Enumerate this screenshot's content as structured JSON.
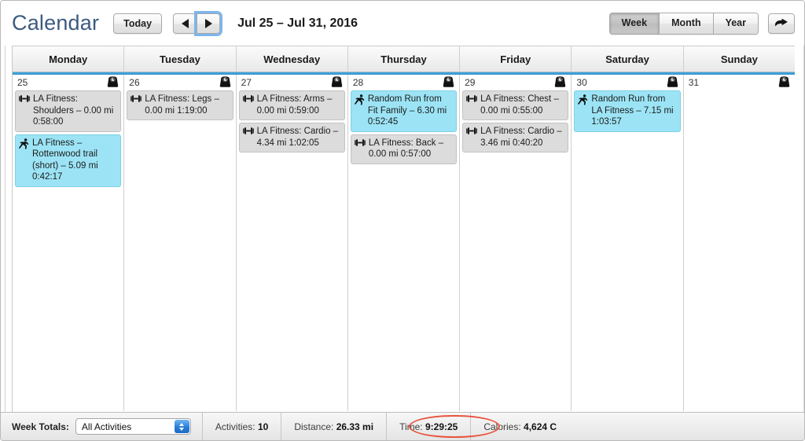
{
  "header": {
    "title": "Calendar",
    "today_label": "Today",
    "prev_icon": "triangle-left-icon",
    "next_icon": "triangle-right-icon",
    "date_range": "Jul 25 – Jul 31, 2016",
    "views": [
      {
        "label": "Week",
        "active": true
      },
      {
        "label": "Month",
        "active": false
      },
      {
        "label": "Year",
        "active": false
      }
    ],
    "share_icon": "share-arrow-icon"
  },
  "calendar": {
    "day_headers": [
      "Monday",
      "Tuesday",
      "Wednesday",
      "Thursday",
      "Friday",
      "Saturday",
      "Sunday"
    ],
    "days": [
      {
        "date": "25",
        "scale_icon": "weight-scale-icon",
        "events": [
          {
            "type": "strength",
            "icon": "dumbbell-icon",
            "text": "LA Fitness: Shoulders – 0.00 mi 0:58:00"
          },
          {
            "type": "run",
            "icon": "runner-icon",
            "text": "LA Fitness – Rottenwood trail (short) – 5.09 mi 0:42:17"
          }
        ]
      },
      {
        "date": "26",
        "scale_icon": "weight-scale-icon",
        "events": [
          {
            "type": "strength",
            "icon": "dumbbell-icon",
            "text": "LA Fitness: Legs – 0.00 mi 1:19:00"
          }
        ]
      },
      {
        "date": "27",
        "scale_icon": "weight-scale-icon",
        "events": [
          {
            "type": "strength",
            "icon": "dumbbell-icon",
            "text": "LA Fitness: Arms – 0.00 mi 0:59:00"
          },
          {
            "type": "strength",
            "icon": "dumbbell-icon",
            "text": "LA Fitness: Cardio – 4.34 mi 1:02:05"
          }
        ]
      },
      {
        "date": "28",
        "scale_icon": "weight-scale-icon",
        "events": [
          {
            "type": "run",
            "icon": "runner-icon",
            "text": "Random Run from Fit Family – 6.30 mi 0:52:45"
          },
          {
            "type": "strength",
            "icon": "dumbbell-icon",
            "text": "LA Fitness: Back – 0.00 mi 0:57:00"
          }
        ]
      },
      {
        "date": "29",
        "scale_icon": "weight-scale-icon",
        "events": [
          {
            "type": "strength",
            "icon": "dumbbell-icon",
            "text": "LA Fitness: Chest – 0.00 mi 0:55:00"
          },
          {
            "type": "strength",
            "icon": "dumbbell-icon",
            "text": "LA Fitness: Cardio – 3.46 mi 0:40:20"
          }
        ]
      },
      {
        "date": "30",
        "scale_icon": "weight-scale-icon",
        "events": [
          {
            "type": "run",
            "icon": "runner-icon",
            "text": "Random Run from LA Fitness – 7.15 mi 1:03:57"
          }
        ]
      },
      {
        "date": "31",
        "scale_icon": "weight-scale-icon",
        "events": []
      }
    ]
  },
  "totals": {
    "label": "Week Totals:",
    "filter_value": "All Activities",
    "items": [
      {
        "label": "Activities:",
        "value": "10"
      },
      {
        "label": "Distance:",
        "value": "26.33 mi"
      },
      {
        "label": "Time:",
        "value": "9:29:25"
      },
      {
        "label": "Calories:",
        "value": "4,624 C"
      }
    ]
  },
  "annotation": {
    "shape": "ellipse",
    "color": "#e8533d",
    "target": "calories-total"
  },
  "colors": {
    "title": "#3d5a80",
    "accent_rule": "#3fa2dd",
    "run_event_bg": "#9ce4f5",
    "strength_event_bg": "#dcdcdc",
    "annotation": "#e8533d",
    "stepper_blue": "#2f86dd"
  }
}
